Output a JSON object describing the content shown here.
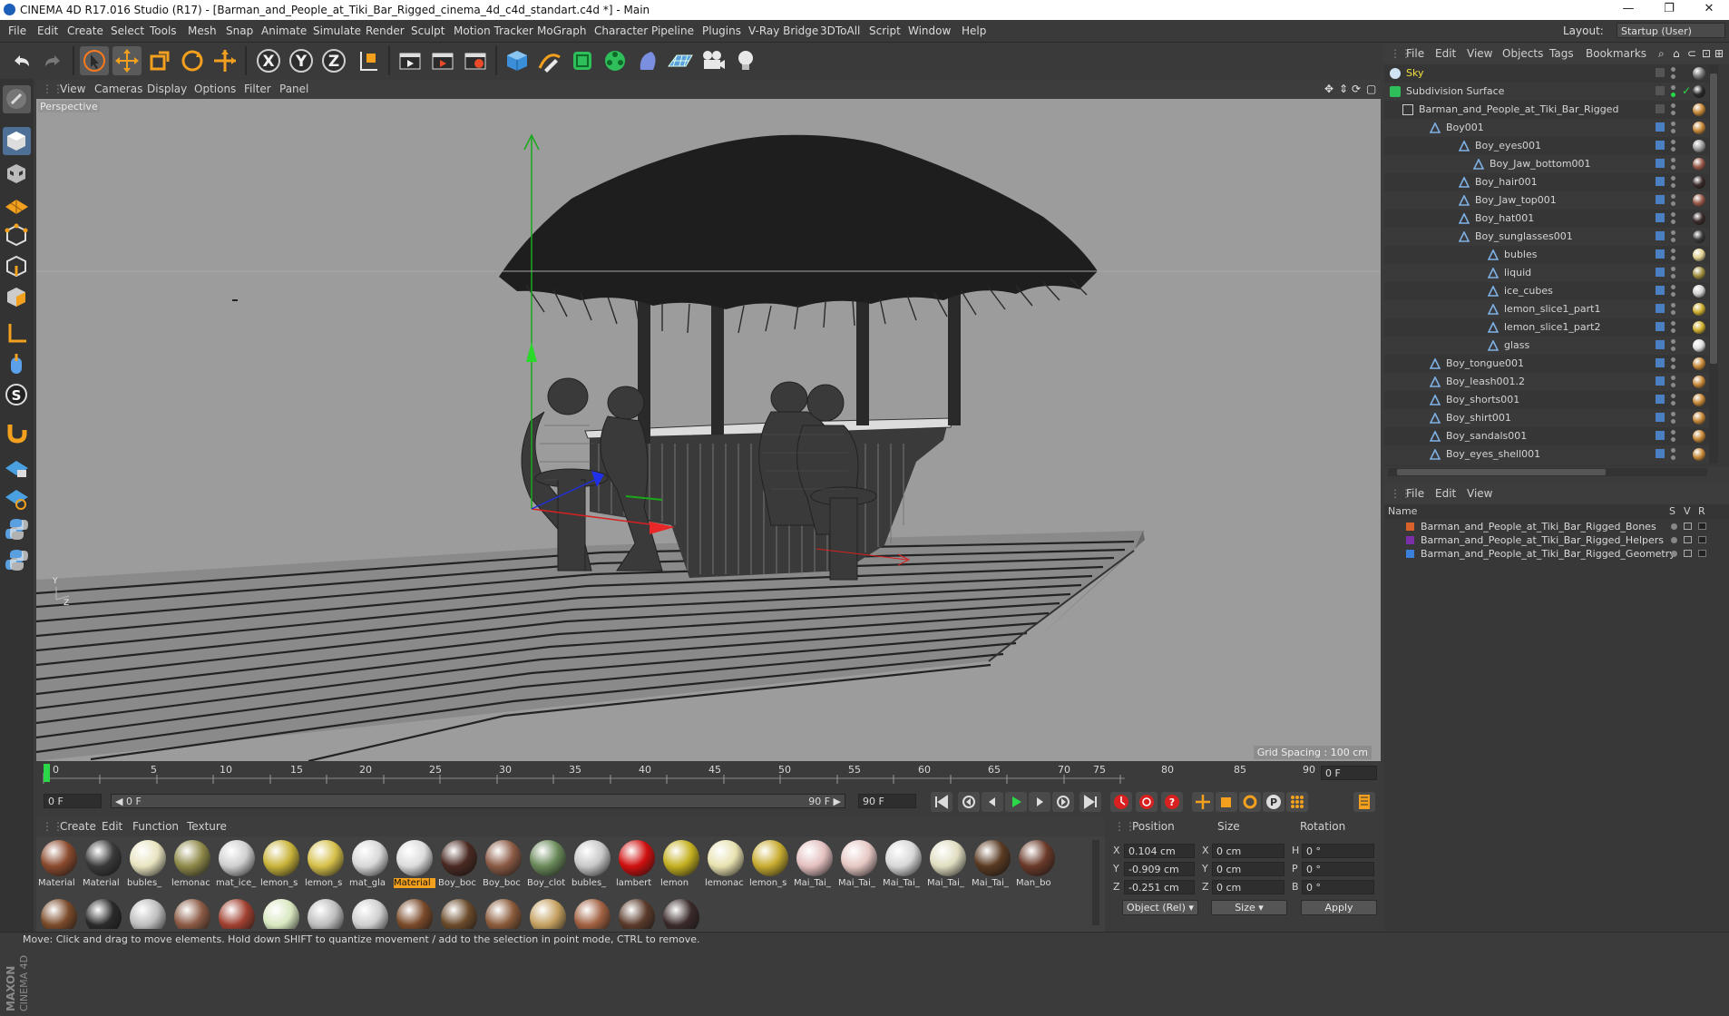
{
  "window": {
    "title": "CINEMA 4D R17.016 Studio (R17) - [Barman_and_People_at_Tiki_Bar_Rigged_cinema_4d_c4d_standart.c4d *] - Main",
    "minimize": "—",
    "restore": "❐",
    "close": "✕"
  },
  "menubar": {
    "items": [
      "File",
      "Edit",
      "Create",
      "Select",
      "Tools",
      "Mesh",
      "Snap",
      "Animate",
      "Simulate",
      "Render",
      "Sculpt",
      "Motion Tracker",
      "MoGraph",
      "Character",
      "Pipeline",
      "Plugins",
      "V-Ray Bridge",
      "3DToAll",
      "Script",
      "Window",
      "Help"
    ],
    "layout_label": "Layout:",
    "layout_value": "Startup (User)"
  },
  "toolbar": {
    "icons": [
      "undo-icon",
      "redo-icon",
      "live-selection-icon",
      "move-icon",
      "scale-icon",
      "rotate-icon",
      "recent-tools-icon",
      "x-axis-icon",
      "y-axis-icon",
      "z-axis-icon",
      "coordinate-system-icon",
      "render-view-icon",
      "render-picture-viewer-icon",
      "edit-render-settings-icon",
      "cube-primitive-icon",
      "pen-spline-icon",
      "subdivision-surface-icon",
      "cloner-icon",
      "deformer-icon",
      "floor-icon",
      "camera-icon",
      "light-icon"
    ],
    "axis_labels": [
      "X",
      "Y",
      "Z"
    ]
  },
  "viewport": {
    "menu": [
      "View",
      "Cameras",
      "Display",
      "Options",
      "Filter",
      "Panel"
    ],
    "label": "Perspective",
    "grid_spacing": "Grid Spacing : 100 cm",
    "axis_y": "Y",
    "axis_z": "Z"
  },
  "timeline": {
    "ticks": [
      "0",
      "5",
      "10",
      "15",
      "20",
      "25",
      "30",
      "35",
      "40",
      "45",
      "50",
      "55",
      "60",
      "65",
      "70",
      "75",
      "80",
      "85",
      "90"
    ],
    "current_frame": "0 F",
    "start_frame": "0 F",
    "range_start": "◀ 0 F",
    "range_end": "90 F ▶",
    "end_frame": "90 F"
  },
  "materials": {
    "menu": [
      "Create",
      "Edit",
      "Function",
      "Texture"
    ],
    "row1": [
      {
        "label": "Material",
        "color": "#8a4a2e"
      },
      {
        "label": "Material",
        "color": "#3a3a3a"
      },
      {
        "label": "bubles_",
        "color": "#e8e4c0"
      },
      {
        "label": "lemonac",
        "color": "#8f8a4a"
      },
      {
        "label": "mat_ice_",
        "color": "#cfcfcf"
      },
      {
        "label": "lemon_s",
        "color": "#c9b43a"
      },
      {
        "label": "lemon_s",
        "color": "#d6c04a"
      },
      {
        "label": "mat_gla",
        "color": "#d8d8d8"
      },
      {
        "label": "Material",
        "color": "#dcdcdc",
        "selected": true
      },
      {
        "label": "Boy_boc",
        "color": "#4a2a22"
      },
      {
        "label": "Boy_boc",
        "color": "#8a5a44"
      },
      {
        "label": "Boy_clot",
        "color": "#6a8a5a"
      },
      {
        "label": "bubles_",
        "color": "#c8c8c8"
      },
      {
        "label": "lambert",
        "color": "#d01010"
      },
      {
        "label": "lemon",
        "color": "#c4b020"
      },
      {
        "label": "lemonac",
        "color": "#e8e2b0"
      },
      {
        "label": "lemon_s",
        "color": "#c8ac30"
      },
      {
        "label": "Mai_Tai_",
        "color": "#e4c0c0"
      },
      {
        "label": "Mai_Tai_",
        "color": "#e6c8c4"
      },
      {
        "label": "Mai_Tai_",
        "color": "#d8d8d8"
      },
      {
        "label": "Mai_Tai_",
        "color": "#e0ddc0"
      },
      {
        "label": "Mai_Tai_",
        "color": "#5a3a22"
      },
      {
        "label": "Man_bo",
        "color": "#6a3a2a"
      }
    ],
    "row2_colors": [
      "#7a4a2a",
      "#2a2a2a",
      "#bdbdbd",
      "#8a5a44",
      "#a04030",
      "#d8e8c0",
      "#bdbdbd",
      "#cfcfcf",
      "#7a4a2a",
      "#6a4a2a",
      "#8a5a3a",
      "#c4a060",
      "#a06040",
      "#5a3a2a",
      "#3a2a2a"
    ]
  },
  "coordinates": {
    "headers": [
      "Position",
      "Size",
      "Rotation"
    ],
    "rows": [
      {
        "axis": "X",
        "pos": "0.104 cm",
        "size_axis": "X",
        "size": "0 cm",
        "rot_axis": "H",
        "rot": "0 °"
      },
      {
        "axis": "Y",
        "pos": "-0.909 cm",
        "size_axis": "Y",
        "size": "0 cm",
        "rot_axis": "P",
        "rot": "0 °"
      },
      {
        "axis": "Z",
        "pos": "-0.251 cm",
        "size_axis": "Z",
        "size": "0 cm",
        "rot_axis": "B",
        "rot": "0 °"
      }
    ],
    "mode": "Object (Rel)",
    "size_mode": "Size",
    "apply": "Apply"
  },
  "status": "Move: Click and drag to move elements. Hold down SHIFT to quantize movement / add to the selection in point mode, CTRL to remove.",
  "objects": {
    "menu": [
      "File",
      "Edit",
      "View",
      "Objects",
      "Tags",
      "Bookmarks"
    ],
    "items": [
      {
        "name": "Sky",
        "indent": 0,
        "type": "sky"
      },
      {
        "name": "Subdivision Surface",
        "indent": 0,
        "type": "subd"
      },
      {
        "name": "Barman_and_People_at_Tiki_Bar_Rigged",
        "indent": 1,
        "type": "null"
      },
      {
        "name": "Boy001",
        "indent": 2,
        "type": "bone"
      },
      {
        "name": "Boy_eyes001",
        "indent": 4,
        "type": "bone"
      },
      {
        "name": "Boy_Jaw_bottom001",
        "indent": 5,
        "type": "bone"
      },
      {
        "name": "Boy_hair001",
        "indent": 4,
        "type": "bone"
      },
      {
        "name": "Boy_Jaw_top001",
        "indent": 4,
        "type": "bone"
      },
      {
        "name": "Boy_hat001",
        "indent": 4,
        "type": "bone"
      },
      {
        "name": "Boy_sunglasses001",
        "indent": 4,
        "type": "bone"
      },
      {
        "name": "bubles",
        "indent": 6,
        "type": "bone"
      },
      {
        "name": "liquid",
        "indent": 6,
        "type": "bone"
      },
      {
        "name": "ice_cubes",
        "indent": 6,
        "type": "bone"
      },
      {
        "name": "lemon_slice1_part1",
        "indent": 6,
        "type": "bone"
      },
      {
        "name": "lemon_slice1_part2",
        "indent": 6,
        "type": "bone"
      },
      {
        "name": "glass",
        "indent": 6,
        "type": "bone"
      },
      {
        "name": "Boy_tongue001",
        "indent": 2,
        "type": "bone"
      },
      {
        "name": "Boy_leash001.2",
        "indent": 2,
        "type": "bone"
      },
      {
        "name": "Boy_shorts001",
        "indent": 2,
        "type": "bone"
      },
      {
        "name": "Boy_shirt001",
        "indent": 2,
        "type": "bone"
      },
      {
        "name": "Boy_sandals001",
        "indent": 2,
        "type": "bone"
      },
      {
        "name": "Boy_eyes_shell001",
        "indent": 2,
        "type": "bone"
      }
    ],
    "tag_colors": [
      "#7a7a7a",
      "#2a2a2a",
      "#c98a3a",
      "#c98a3a",
      "#a0a0a0",
      "#9a5a4a",
      "#3a2a2a",
      "#9a5a4a",
      "#3a2a2a",
      "#3a3a3a",
      "#e0d090",
      "#a09040",
      "#d0d0d0",
      "#d0b030",
      "#d0b030",
      "#e0e0e0",
      "#c98a3a",
      "#c98a3a",
      "#c98a3a",
      "#c98a3a",
      "#c98a3a",
      "#c98a3a"
    ]
  },
  "layers": {
    "menu": [
      "File",
      "Edit",
      "View"
    ],
    "header": {
      "name": "Name",
      "s": "S",
      "v": "V",
      "r": "R"
    },
    "items": [
      {
        "name": "Barman_and_People_at_Tiki_Bar_Rigged_Bones",
        "color": "#d9622b"
      },
      {
        "name": "Barman_and_People_at_Tiki_Bar_Rigged_Helpers",
        "color": "#7a2fa8"
      },
      {
        "name": "Barman_and_People_at_Tiki_Bar_Rigged_Geometry",
        "color": "#3a7fd9"
      }
    ]
  }
}
